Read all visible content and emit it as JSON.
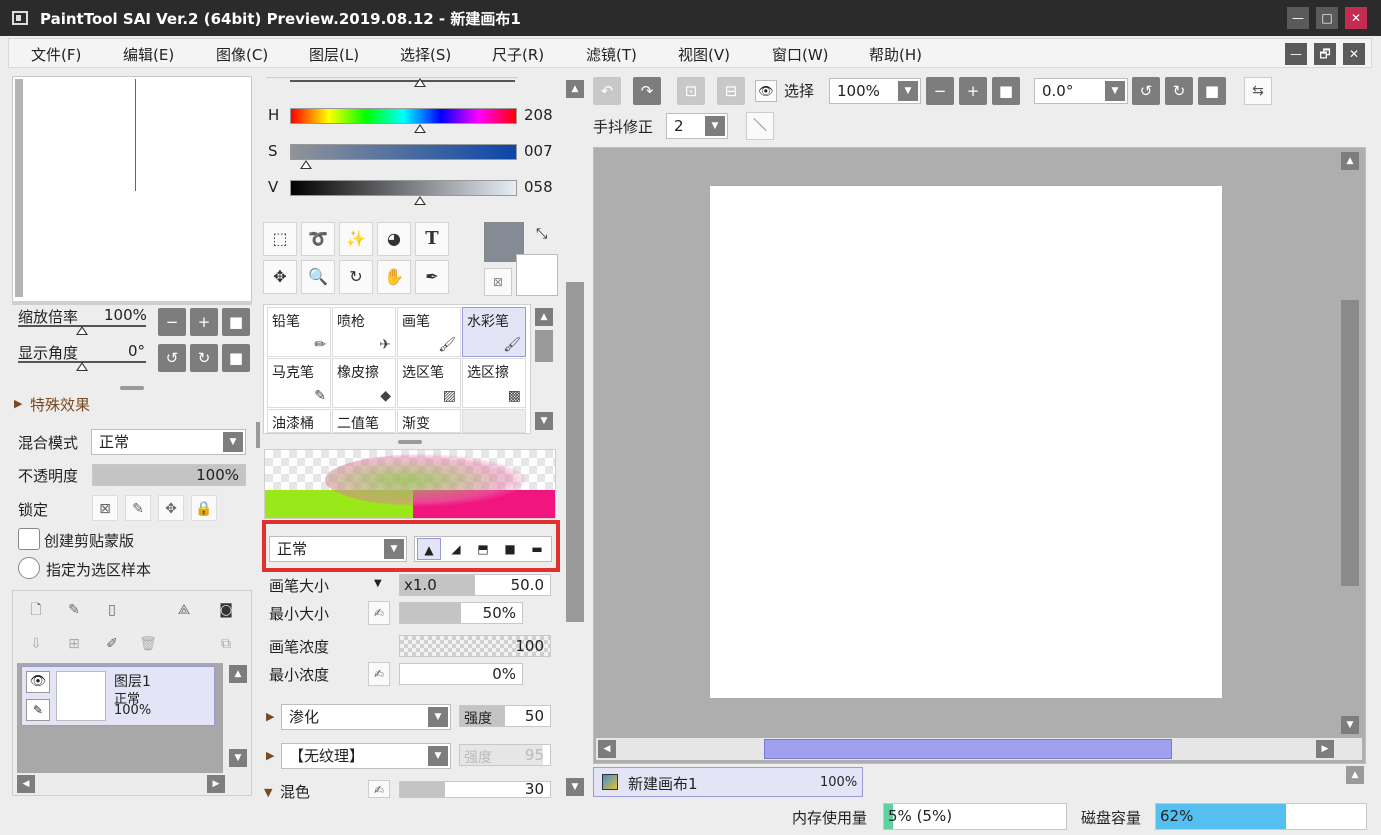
{
  "window": {
    "title": "PaintTool SAI Ver.2 (64bit) Preview.2019.08.12 - 新建画布1",
    "minimize": "—",
    "maximize": "□",
    "close": "✕"
  },
  "menu": {
    "items": [
      "文件(F)",
      "编辑(E)",
      "图像(C)",
      "图层(L)",
      "选择(S)",
      "尺子(R)",
      "滤镜(T)",
      "视图(V)",
      "窗口(W)",
      "帮助(H)"
    ],
    "restore": "🗗"
  },
  "navigator": {
    "zoom_label": "缩放倍率",
    "zoom_value": "100%",
    "angle_label": "显示角度",
    "angle_value": "0°"
  },
  "layer_props": {
    "effects_label": "特殊效果",
    "blend_label": "混合模式",
    "blend_value": "正常",
    "opacity_label": "不透明度",
    "opacity_value": "100%",
    "opacity_fraction": 1.0,
    "lock_label": "锁定",
    "clip_label": "创建剪贴蒙版",
    "sample_label": "指定为选区样本"
  },
  "layers": [
    {
      "name": "图层1",
      "mode": "正常",
      "opacity": "100%"
    }
  ],
  "color": {
    "h_label": "H",
    "h_value": "208",
    "s_label": "S",
    "s_value": "007",
    "v_label": "V",
    "v_value": "058",
    "primary": "#858b94",
    "secondary": "#ffffff"
  },
  "brushes": [
    [
      "铅笔",
      "喷枪",
      "画笔",
      "水彩笔"
    ],
    [
      "马克笔",
      "橡皮擦",
      "选区笔",
      "选区擦"
    ],
    [
      "油漆桶",
      "二值笔",
      "渐变",
      ""
    ]
  ],
  "brush_settings": {
    "mode_value": "正常",
    "size_label": "画笔大小",
    "size_mult": "x1.0",
    "size_value": "50.0",
    "min_size_label": "最小大小",
    "min_size_value": "50%",
    "density_label": "画笔浓度",
    "density_value": "100",
    "min_density_label": "最小浓度",
    "min_density_value": "0%",
    "blend_value": "渗化",
    "strength_label": "强度",
    "strength_value": "50",
    "texture_value": "【无纹理】",
    "texture_strength_label": "强度",
    "texture_strength_value": "95",
    "mix_label": "混色",
    "mix_value": "30"
  },
  "toolbar": {
    "select_label": "选择",
    "zoom_value": "100%",
    "angle_value": "0.0°",
    "stabilizer_label": "手抖修正",
    "stabilizer_value": "2"
  },
  "canvas_tabs": [
    {
      "name": "新建画布1",
      "zoom": "100%"
    }
  ],
  "status": {
    "memory_label": "内存使用量",
    "memory_value": "5% (5%)",
    "memory_fraction": 0.05,
    "disk_label": "磁盘容量",
    "disk_value": "62%",
    "disk_fraction": 0.62
  },
  "colors": {
    "titlebar": "#2b2b2b",
    "close_button": "#c42b50",
    "highlight": "#e03030",
    "scroll_thumb": "#a0a0f0",
    "disk_fill": "#55c0f0",
    "memory_fill": "#60d0a0"
  }
}
